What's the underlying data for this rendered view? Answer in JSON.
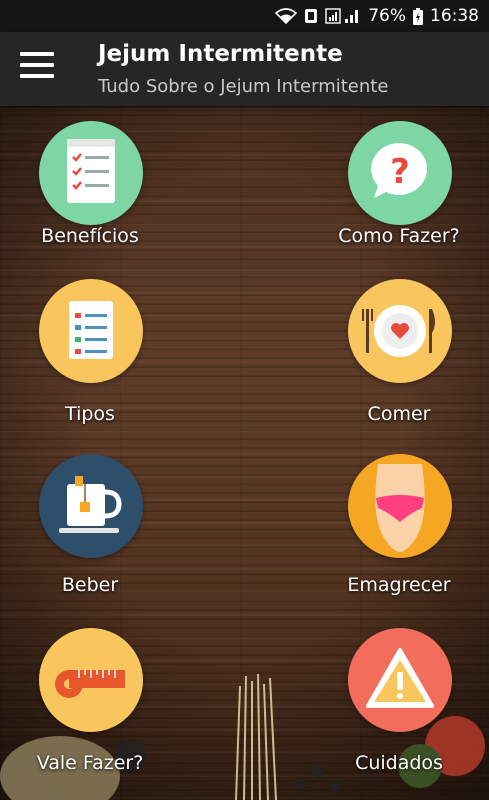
{
  "status_bar": {
    "battery": "76%",
    "time": "16:38",
    "icons": [
      "wifi-icon",
      "sync-icon",
      "signal-icon",
      "battery-icon"
    ]
  },
  "app_bar": {
    "title": "Jejum Intermitente",
    "subtitle": "Tudo Sobre o Jejum Intermitente",
    "menu_icon": "hamburger-menu-icon"
  },
  "menu": {
    "items": [
      {
        "label": "Benefícios",
        "icon": "checklist-icon",
        "color": "#7ed6a4"
      },
      {
        "label": "Como Fazer?",
        "icon": "question-bubble-icon",
        "color": "#7ed6a4"
      },
      {
        "label": "Tipos",
        "icon": "document-list-icon",
        "color": "#f8c65c"
      },
      {
        "label": "Comer",
        "icon": "plate-cutlery-icon",
        "color": "#f8c65c"
      },
      {
        "label": "Beber",
        "icon": "tea-mug-icon",
        "color": "#2d4f6c"
      },
      {
        "label": "Emagrecer",
        "icon": "hips-icon",
        "color": "#f5a623"
      },
      {
        "label": "Vale Fazer?",
        "icon": "measuring-tape-icon",
        "color": "#f8c65c"
      },
      {
        "label": "Cuidados",
        "icon": "warning-icon",
        "color": "#f26d5b"
      }
    ]
  }
}
